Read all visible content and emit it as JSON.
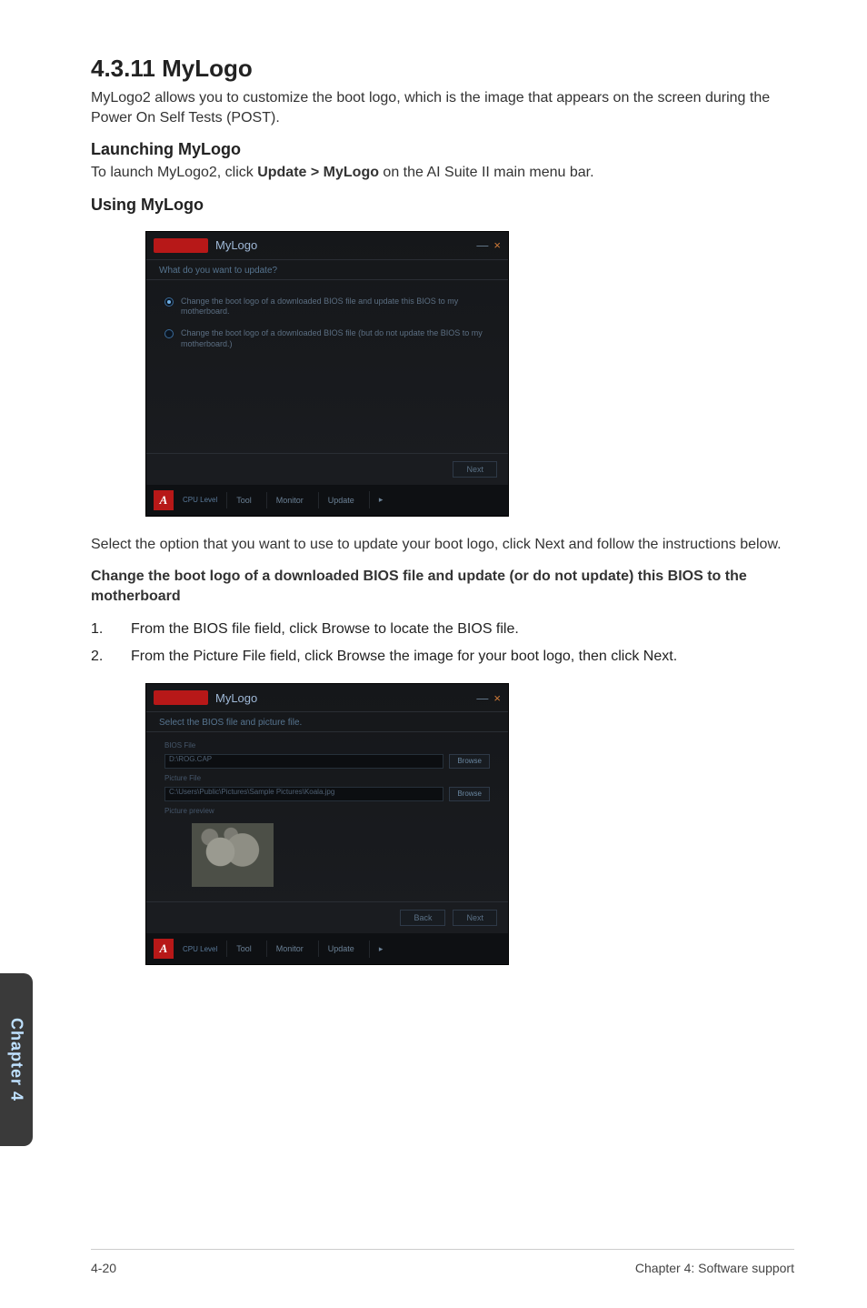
{
  "heading": "4.3.11    MyLogo",
  "intro": "MyLogo2 allows you to customize the boot logo, which is the image that appears on the screen during the Power On Self Tests (POST).",
  "launch_h": "Launching MyLogo",
  "launch_p_pre": "To launch MyLogo2, click ",
  "launch_p_bold": "Update > MyLogo",
  "launch_p_post": " on the AI Suite II main menu bar.",
  "using_h": "Using MyLogo",
  "shot1": {
    "title": "MyLogo",
    "question": "What do you want to update?",
    "opt1": "Change the boot logo of a downloaded BIOS file and update this BIOS to my motherboard.",
    "opt2": "Change the boot logo of a downloaded BIOS file (but do not update the BIOS to my motherboard.)",
    "next": "Next",
    "cpu": "CPU Level",
    "tool": "Tool",
    "monitor": "Monitor",
    "update": "Update"
  },
  "mid_p": "Select the option that you want to use to update your boot logo, click Next and follow the instructions below.",
  "mid_b": "Change the boot logo of a downloaded BIOS file and update (or do not update) this BIOS to the motherboard",
  "step1_n": "1.",
  "step1": "From the BIOS file field, click Browse to locate the BIOS file.",
  "step2_n": "2.",
  "step2": "From the Picture File field, click Browse the image for your boot logo, then click Next.",
  "shot2": {
    "title": "MyLogo",
    "sub": "Select the BIOS file and picture file.",
    "bios_label": "BIOS File",
    "bios_val": "D:\\ROG.CAP",
    "pic_label": "Picture File",
    "pic_val": "C:\\Users\\Public\\Pictures\\Sample Pictures\\Koala.jpg",
    "preview_label": "Picture preview",
    "browse": "Browse",
    "back": "Back",
    "next": "Next",
    "cpu": "CPU Level",
    "tool": "Tool",
    "monitor": "Monitor",
    "update": "Update"
  },
  "side": "Chapter 4",
  "footer_left": "4-20",
  "footer_right": "Chapter 4: Software support"
}
